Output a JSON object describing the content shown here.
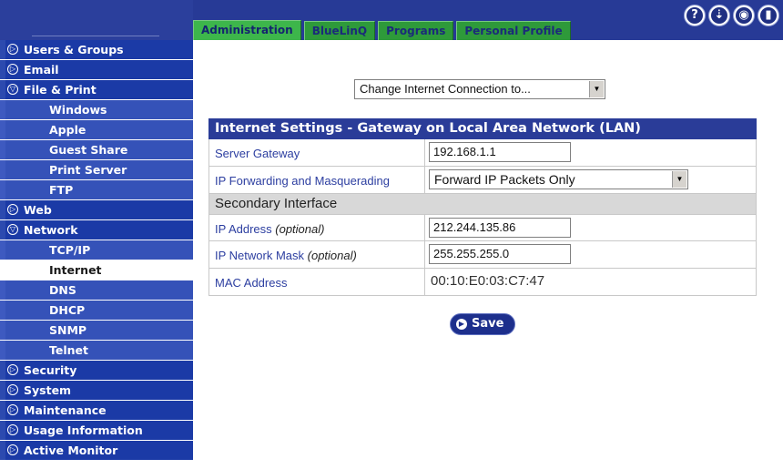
{
  "tabs": [
    "Administration",
    "BlueLinQ",
    "Programs",
    "Personal Profile"
  ],
  "top_icons": [
    "help-icon",
    "inbox-icon",
    "eye-icon",
    "door-icon"
  ],
  "sidebar": {
    "items": [
      {
        "label": "Users & Groups",
        "level": "top",
        "state": "collapsed"
      },
      {
        "label": "Email",
        "level": "top",
        "state": "collapsed"
      },
      {
        "label": "File & Print",
        "level": "top",
        "state": "expanded"
      },
      {
        "label": "Windows",
        "level": "sub"
      },
      {
        "label": "Apple",
        "level": "sub"
      },
      {
        "label": "Guest Share",
        "level": "sub"
      },
      {
        "label": "Print Server",
        "level": "sub"
      },
      {
        "label": "FTP",
        "level": "sub"
      },
      {
        "label": "Web",
        "level": "top",
        "state": "collapsed"
      },
      {
        "label": "Network",
        "level": "top",
        "state": "expanded"
      },
      {
        "label": "TCP/IP",
        "level": "sub"
      },
      {
        "label": "Internet",
        "level": "sub",
        "active": true
      },
      {
        "label": "DNS",
        "level": "sub"
      },
      {
        "label": "DHCP",
        "level": "sub"
      },
      {
        "label": "SNMP",
        "level": "sub"
      },
      {
        "label": "Telnet",
        "level": "sub"
      },
      {
        "label": "Security",
        "level": "top",
        "state": "collapsed"
      },
      {
        "label": "System",
        "level": "top",
        "state": "collapsed"
      },
      {
        "label": "Maintenance",
        "level": "top",
        "state": "collapsed"
      },
      {
        "label": "Usage Information",
        "level": "top",
        "state": "collapsed"
      },
      {
        "label": "Active Monitor",
        "level": "top",
        "state": "collapsed"
      }
    ]
  },
  "connection_select": "Change Internet Connection to...",
  "panel": {
    "title": "Internet Settings - Gateway on Local Area Network (LAN)",
    "server_gateway_label": "Server Gateway",
    "server_gateway_value": "192.168.1.1",
    "ip_forwarding_label": "IP Forwarding and Masquerading",
    "ip_forwarding_value": "Forward IP Packets Only",
    "secondary_interface": "Secondary Interface",
    "ip_address_label": "IP Address",
    "optional_text": "(optional)",
    "ip_address_value": "212.244.135.86",
    "ip_mask_label": "IP Network Mask",
    "ip_mask_value": "255.255.255.0",
    "mac_label": "MAC Address",
    "mac_value": "00:10:E0:03:C7:47"
  },
  "save_label": "Save",
  "colors": {
    "topbar": "#273a96",
    "tab_green": "#3db64b",
    "nav_blue": "#1f3ea8",
    "panel_header": "#2a3c98"
  }
}
